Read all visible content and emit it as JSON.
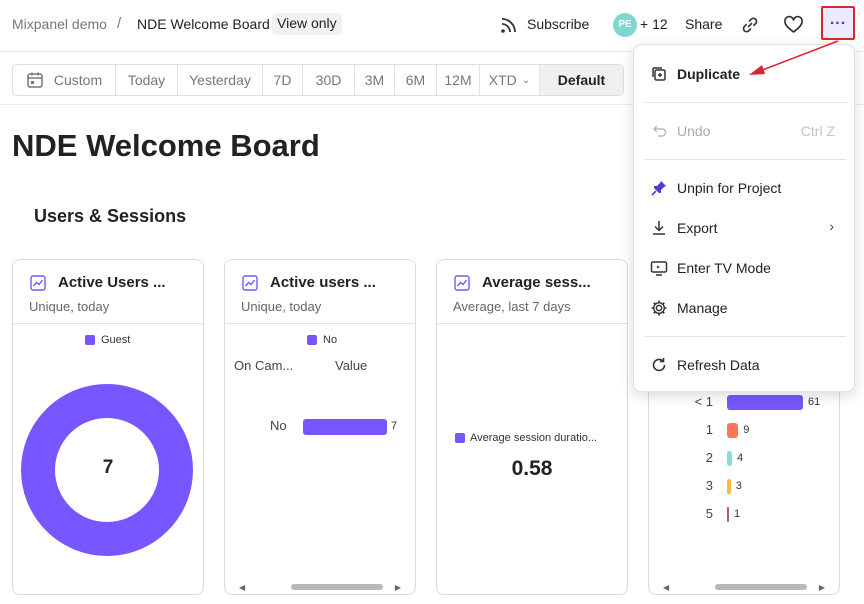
{
  "breadcrumb": {
    "project": "Mixpanel demo",
    "separator": "/",
    "board": "NDE Welcome Board",
    "access_badge": "View only"
  },
  "header": {
    "subscribe_label": "Subscribe",
    "avatar_initials": "PE",
    "extra_members": "+ 12",
    "share_label": "Share",
    "more_label": "..."
  },
  "date_range": {
    "custom_label": "Custom",
    "options": [
      "Today",
      "Yesterday",
      "7D",
      "30D",
      "3M",
      "6M",
      "12M",
      "XTD"
    ],
    "default_label": "Default"
  },
  "page_title": "NDE Welcome Board",
  "section_title": "Users & Sessions",
  "cards": [
    {
      "title": "Active Users ...",
      "subtitle": "Unique, today",
      "legend": "Guest",
      "center_value": "7",
      "chart_data": {
        "type": "pie",
        "categories": [
          "Guest"
        ],
        "values": [
          7
        ]
      }
    },
    {
      "title": "Active users ...",
      "subtitle": "Unique, today",
      "legend": "No",
      "col1_header": "On Cam...",
      "col2_header": "Value",
      "chart_data": {
        "type": "bar",
        "categories": [
          "No"
        ],
        "values": [
          7
        ]
      }
    },
    {
      "title": "Average sess...",
      "subtitle": "Average, last 7 days",
      "legend": "Average session duratio...",
      "value": "0.58"
    },
    {
      "chart_data": {
        "type": "bar",
        "categories": [
          "< 1",
          "1",
          "2",
          "3",
          "5"
        ],
        "values": [
          61,
          9,
          4,
          3,
          1
        ]
      },
      "colors": [
        "#7856ff",
        "#ff7557",
        "#80e1d9",
        "#f8bc3b",
        "#b2596e"
      ]
    }
  ],
  "menu": {
    "duplicate": "Duplicate",
    "undo": "Undo",
    "undo_shortcut": "Ctrl Z",
    "unpin": "Unpin for Project",
    "export": "Export",
    "tv_mode": "Enter TV Mode",
    "manage": "Manage",
    "refresh": "Refresh Data"
  },
  "colors": {
    "accent": "#7856ff",
    "highlight": "#e0242d"
  }
}
